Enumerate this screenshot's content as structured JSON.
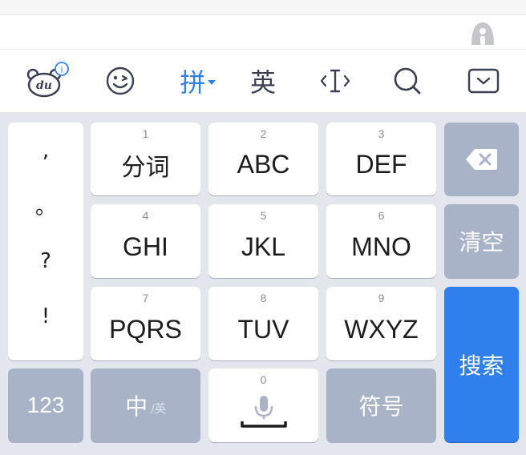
{
  "toolbar": {
    "items": [
      {
        "icon": "du-logo-icon",
        "badge": "i"
      },
      {
        "icon": "emoji-icon"
      },
      {
        "label": "拼",
        "icon": "dropdown-caret-icon"
      },
      {
        "label": "英"
      },
      {
        "icon": "cursor-icon"
      },
      {
        "icon": "search-icon"
      },
      {
        "icon": "collapse-keyboard-icon"
      }
    ]
  },
  "keyboard": {
    "punctuation": [
      ",",
      "。",
      "?",
      "!"
    ],
    "keys": [
      {
        "num": "1",
        "label": "分词"
      },
      {
        "num": "2",
        "label": "ABC"
      },
      {
        "num": "3",
        "label": "DEF"
      },
      {
        "num": "4",
        "label": "GHI"
      },
      {
        "num": "5",
        "label": "JKL"
      },
      {
        "num": "6",
        "label": "MNO"
      },
      {
        "num": "7",
        "label": "PQRS"
      },
      {
        "num": "8",
        "label": "TUV"
      },
      {
        "num": "9",
        "label": "WXYZ"
      }
    ],
    "backspace_icon": "backspace-icon",
    "clear": "清空",
    "search": "搜索",
    "num_switch": "123",
    "lang_main": "中",
    "lang_sub": "/英",
    "space_num": "0",
    "space_icon": "microphone-icon",
    "symbols": "符号"
  },
  "colors": {
    "accent": "#2f80ed",
    "gray_key": "#a8b3c8",
    "background": "#e3e6ec"
  }
}
